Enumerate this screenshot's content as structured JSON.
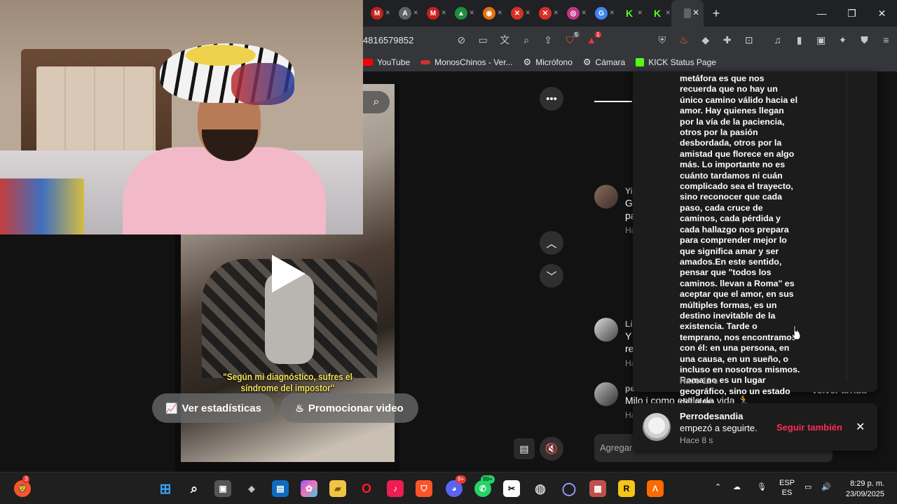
{
  "browser": {
    "tabs": [
      {
        "icon": "gmail-icon",
        "letter": "M",
        "color": "#c5221f"
      },
      {
        "icon": "artstation-icon",
        "letter": "A",
        "color": "#5f6368"
      },
      {
        "icon": "gmail-icon",
        "letter": "M",
        "color": "#c5221f"
      },
      {
        "icon": "drive-icon",
        "letter": "▲",
        "color": "#1e8e3e"
      },
      {
        "icon": "crunchyroll-icon",
        "letter": "◉",
        "color": "#e8710a"
      },
      {
        "icon": "tools-icon",
        "letter": "✕",
        "color": "#d93025"
      },
      {
        "icon": "tools-icon",
        "letter": "✕",
        "color": "#d93025"
      },
      {
        "icon": "instagram-icon",
        "letter": "◎",
        "color": "#c13584"
      },
      {
        "icon": "google-icon",
        "letter": "G",
        "color": "#4285f4"
      },
      {
        "icon": "kick-icon",
        "letter": "K",
        "color": "#53fc18"
      },
      {
        "icon": "kick-icon",
        "letter": "K",
        "color": "#53fc18"
      }
    ],
    "active_tab_close": "✕",
    "new_tab": "+",
    "window_controls": {
      "minimize": "—",
      "maximize": "❐",
      "close": "✕"
    },
    "url": "4816579852",
    "brave_badge": "5",
    "alert_badge": "1"
  },
  "bookmarks": [
    {
      "label": "YouTube",
      "icon": "youtube-icon",
      "color": "#ff0000"
    },
    {
      "label": "MonosChinos - Ver...",
      "icon": "monoschinos-icon",
      "color": "#d32f2f"
    },
    {
      "label": "Micrófono",
      "icon": "gear-icon",
      "color": ""
    },
    {
      "label": "Cámara",
      "icon": "gear-icon",
      "color": ""
    },
    {
      "label": "KICK Status Page",
      "icon": "kick-icon",
      "color": "#53fc18"
    }
  ],
  "video": {
    "caption": "\"Según mi diagnóstico, sufres el síndrome del impostor\"",
    "stats_label": "Ver estadísticas",
    "promote_label": "Promocionar video"
  },
  "comments": {
    "items": [
      {
        "name": "Yi",
        "text": "G",
        "text2": "pa",
        "time": "Ha"
      },
      {
        "name": "Li",
        "text": "Y",
        "text2": "re",
        "time": "Ha"
      },
      {
        "name": "pe",
        "text": "Milo i como estilo de vida 🏃",
        "text2": "",
        "time": "Ha"
      }
    ],
    "back_to_top": "Volver arriba",
    "add_placeholder": "Agregar"
  },
  "notification": {
    "text": "metáfora es que nos recuerda que no hay un único camino válido hacia el amor. Hay quienes llegan por la vía de la paciencia, otros por la pasión desbordada, otros por la amistad que florece en algo más. Lo importante no es cuánto tardamos ni cuán complicado sea el trayecto, sino reconocer que cada paso, cada cruce de caminos, cada pérdida y cada hallazgo nos prepara para comprender mejor lo que significa amar y ser amados.En este sentido, pensar que \"todos los caminos. llevan a Roma\" es aceptar que el amor, en sus múltiples formas, es un destino inevitable de la existencia. Tarde o temprano, nos encontramos con él: en una persona, en una causa, en un sueño, o incluso en nosotros mismos. Roma no es un lugar geográfico, sino un estado del alma.",
    "time": "Hace 11 s"
  },
  "follow": {
    "name": "Perrodesandia",
    "message": "empezó a seguirte.",
    "time": "Hace 8 s",
    "button": "Seguir también"
  },
  "taskbar": {
    "brave_badge": "3",
    "discord_badge": "9+",
    "whatsapp_badge": "99+",
    "lang_top": "ESP",
    "lang_bottom": "ES",
    "time": "8:29 p. m.",
    "date": "23/09/2025"
  }
}
